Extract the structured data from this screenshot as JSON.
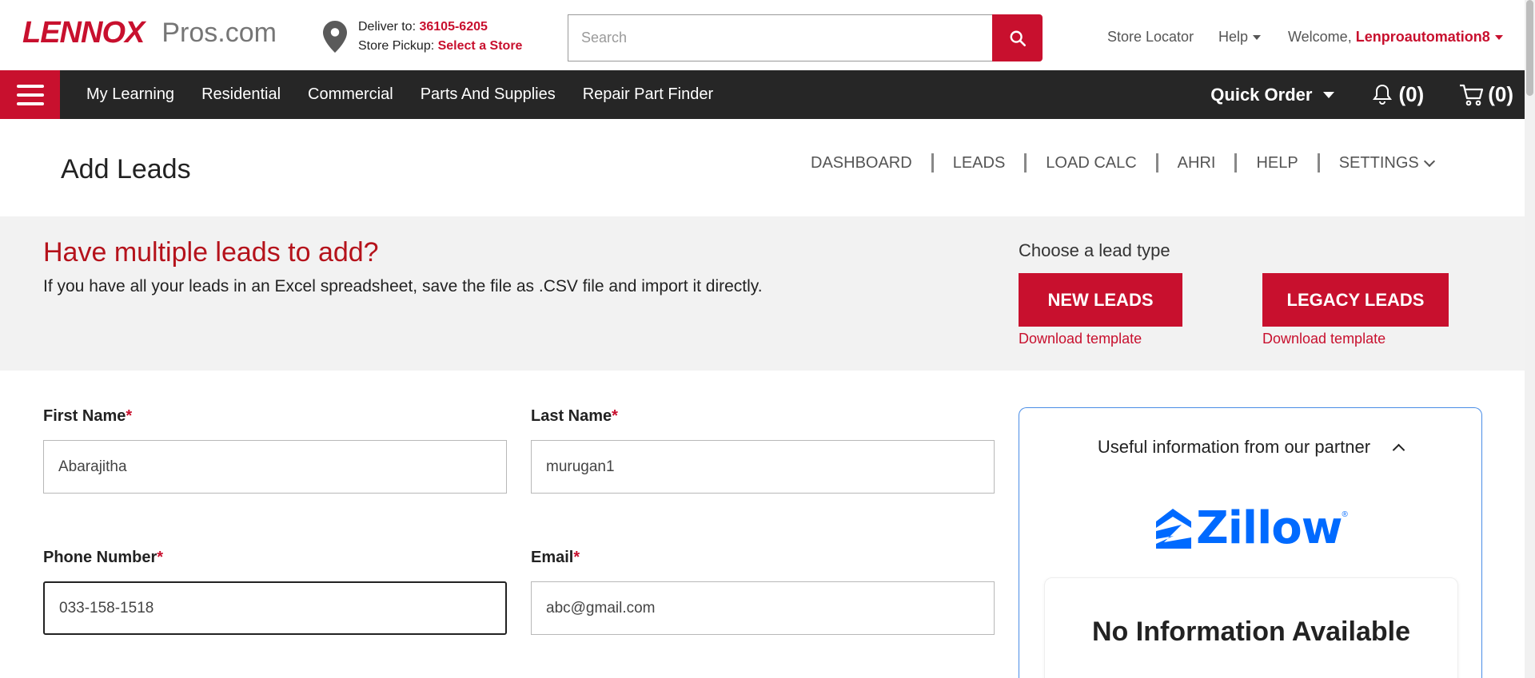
{
  "brand": {
    "logo_main": "LENNOX",
    "logo_sub": "Pros.com"
  },
  "delivery": {
    "deliver_label": "Deliver to:",
    "deliver_zip": "36105-6205",
    "pickup_label": "Store Pickup:",
    "pickup_link": "Select a Store"
  },
  "search": {
    "placeholder": "Search"
  },
  "utility": {
    "store_locator": "Store Locator",
    "help": "Help",
    "welcome": "Welcome,",
    "username": "Lenproautomation8"
  },
  "nav": {
    "items": [
      "My Learning",
      "Residential",
      "Commercial",
      "Parts And Supplies",
      "Repair Part Finder"
    ],
    "quick_order": "Quick Order",
    "notifications": "(0)",
    "cart": "(0)"
  },
  "page": {
    "title": "Add Leads"
  },
  "subnav": {
    "items": [
      "DASHBOARD",
      "LEADS",
      "LOAD CALC",
      "AHRI",
      "HELP",
      "SETTINGS"
    ]
  },
  "banner": {
    "title": "Have multiple leads to add?",
    "text": "If you have all your leads in an Excel spreadsheet, save the file as .CSV file and import it directly.",
    "lead_type_label": "Choose a lead type",
    "new_leads": "NEW LEADS",
    "legacy_leads": "LEGACY LEADS",
    "download_template": "Download template"
  },
  "form": {
    "first_name": {
      "label": "First Name",
      "value": "Abarajitha"
    },
    "last_name": {
      "label": "Last Name",
      "value": "murugan1"
    },
    "phone": {
      "label": "Phone Number",
      "value": "033-158-1518"
    },
    "email": {
      "label": "Email",
      "value": "abc@gmail.com"
    },
    "required_mark": "*"
  },
  "partner": {
    "heading": "Useful information from our partner",
    "partner_logo": "Zillow",
    "no_info": "No Information Available"
  },
  "colors": {
    "brand_red": "#c8102e",
    "nav_bg": "#262626",
    "zillow_blue": "#006aff"
  }
}
